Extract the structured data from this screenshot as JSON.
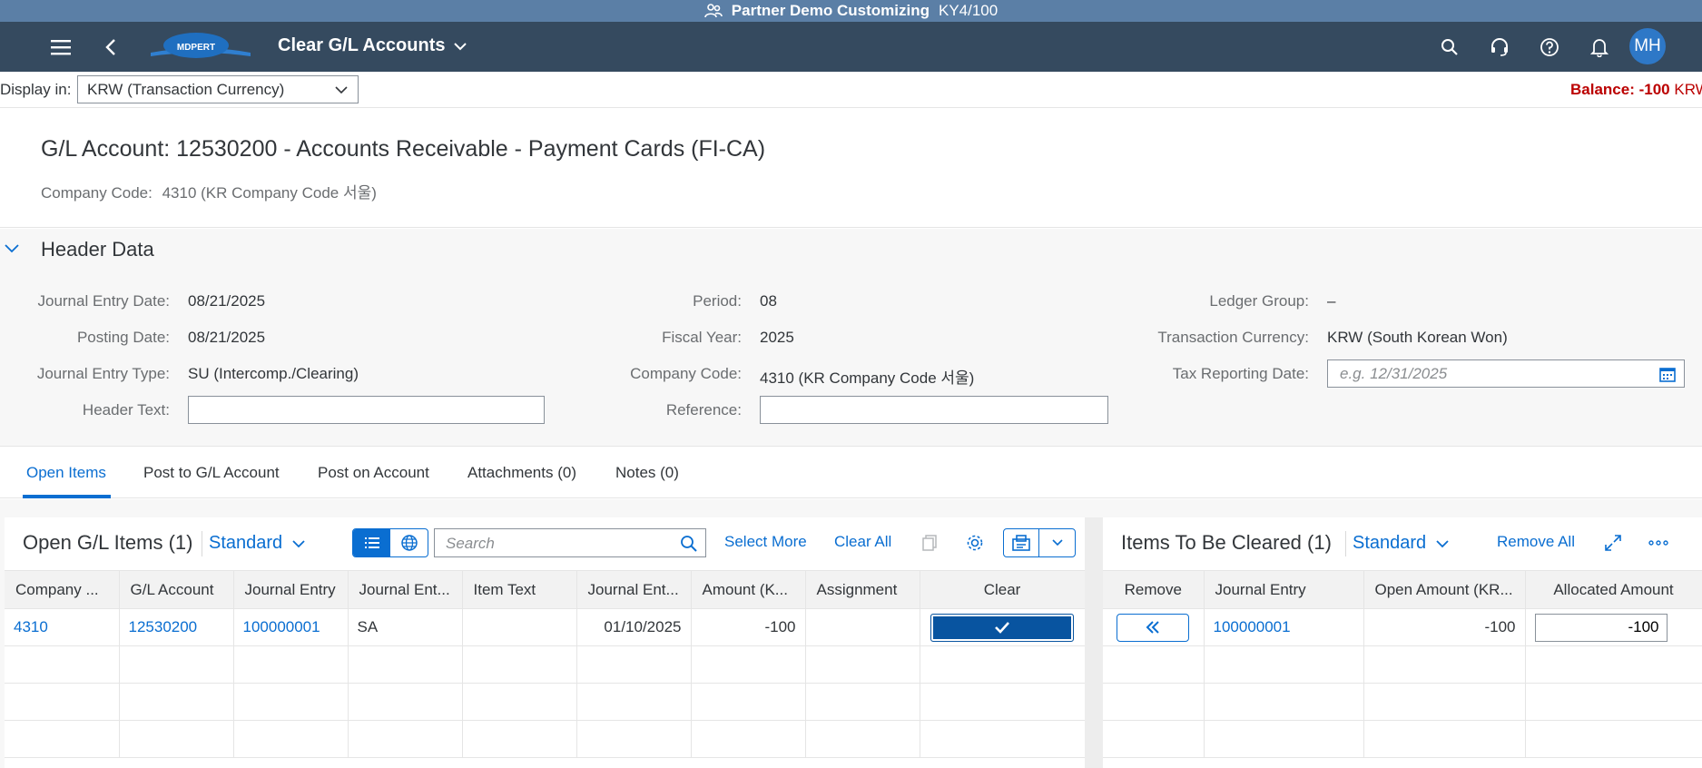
{
  "system_bar": {
    "title": "Partner Demo Customizing",
    "system": "KY4/100"
  },
  "shell": {
    "logo_text": "MDPERT",
    "app_title": "Clear G/L Accounts",
    "avatar_initials": "MH",
    "icons": [
      "menu-icon",
      "back-icon",
      "search-icon",
      "headset-icon",
      "help-icon",
      "bell-icon"
    ]
  },
  "toolbar": {
    "display_in_label": "Display in:",
    "currency_value": "KRW (Transaction Currency)",
    "balance_label": "Balance: -100",
    "balance_currency": "KRW"
  },
  "object_header": {
    "title": "G/L Account: 12530200 - Accounts Receivable - Payment Cards (FI-CA)",
    "company_code_label": "Company Code:",
    "company_code_value": "4310 (KR Company Code 서울)"
  },
  "header_data": {
    "title": "Header Data",
    "journal_entry_date_label": "Journal Entry Date:",
    "journal_entry_date": "08/21/2025",
    "posting_date_label": "Posting Date:",
    "posting_date": "08/21/2025",
    "journal_entry_type_label": "Journal Entry Type:",
    "journal_entry_type": "SU (Intercomp./Clearing)",
    "header_text_label": "Header Text:",
    "header_text": "",
    "period_label": "Period:",
    "period": "08",
    "fiscal_year_label": "Fiscal Year:",
    "fiscal_year": "2025",
    "company_code_label": "Company Code:",
    "company_code": "4310 (KR Company Code 서울)",
    "reference_label": "Reference:",
    "reference": "",
    "ledger_group_label": "Ledger Group:",
    "ledger_group": "–",
    "transaction_currency_label": "Transaction Currency:",
    "transaction_currency": "KRW (South Korean Won)",
    "tax_reporting_date_label": "Tax Reporting Date:",
    "tax_reporting_date_placeholder": "e.g. 12/31/2025"
  },
  "tabs": [
    {
      "label": "Open Items",
      "active": true
    },
    {
      "label": "Post to G/L Account"
    },
    {
      "label": "Post on Account"
    },
    {
      "label": "Attachments (0)"
    },
    {
      "label": "Notes (0)"
    }
  ],
  "open_items": {
    "title": "Open G/L Items (1)",
    "variant": "Standard",
    "search_placeholder": "Search",
    "select_more": "Select More",
    "clear_all": "Clear All",
    "columns": [
      "Company ...",
      "G/L Account",
      "Journal Entry",
      "Journal Ent...",
      "Item Text",
      "Journal Ent...",
      "Amount (K...",
      "Assignment",
      "Clear"
    ],
    "row": {
      "company": "4310",
      "gl_account": "12530200",
      "journal_entry": "100000001",
      "journal_entry_type": "SA",
      "item_text": "",
      "journal_entry_date": "01/10/2025",
      "amount": "-100",
      "assignment": ""
    }
  },
  "to_be_cleared": {
    "title": "Items To Be Cleared (1)",
    "variant": "Standard",
    "remove_all": "Remove All",
    "columns": [
      "Remove",
      "Journal Entry",
      "Open Amount (KR...",
      "Allocated Amount"
    ],
    "row": {
      "journal_entry": "100000001",
      "open_amount": "-100",
      "allocated_amount": "-100"
    }
  },
  "colors": {
    "shell": "#354a5f",
    "system_bar": "#5b7fa6",
    "accent": "#0a6ed1",
    "negative": "#bb0000",
    "button_emphasized": "#0854a0"
  }
}
